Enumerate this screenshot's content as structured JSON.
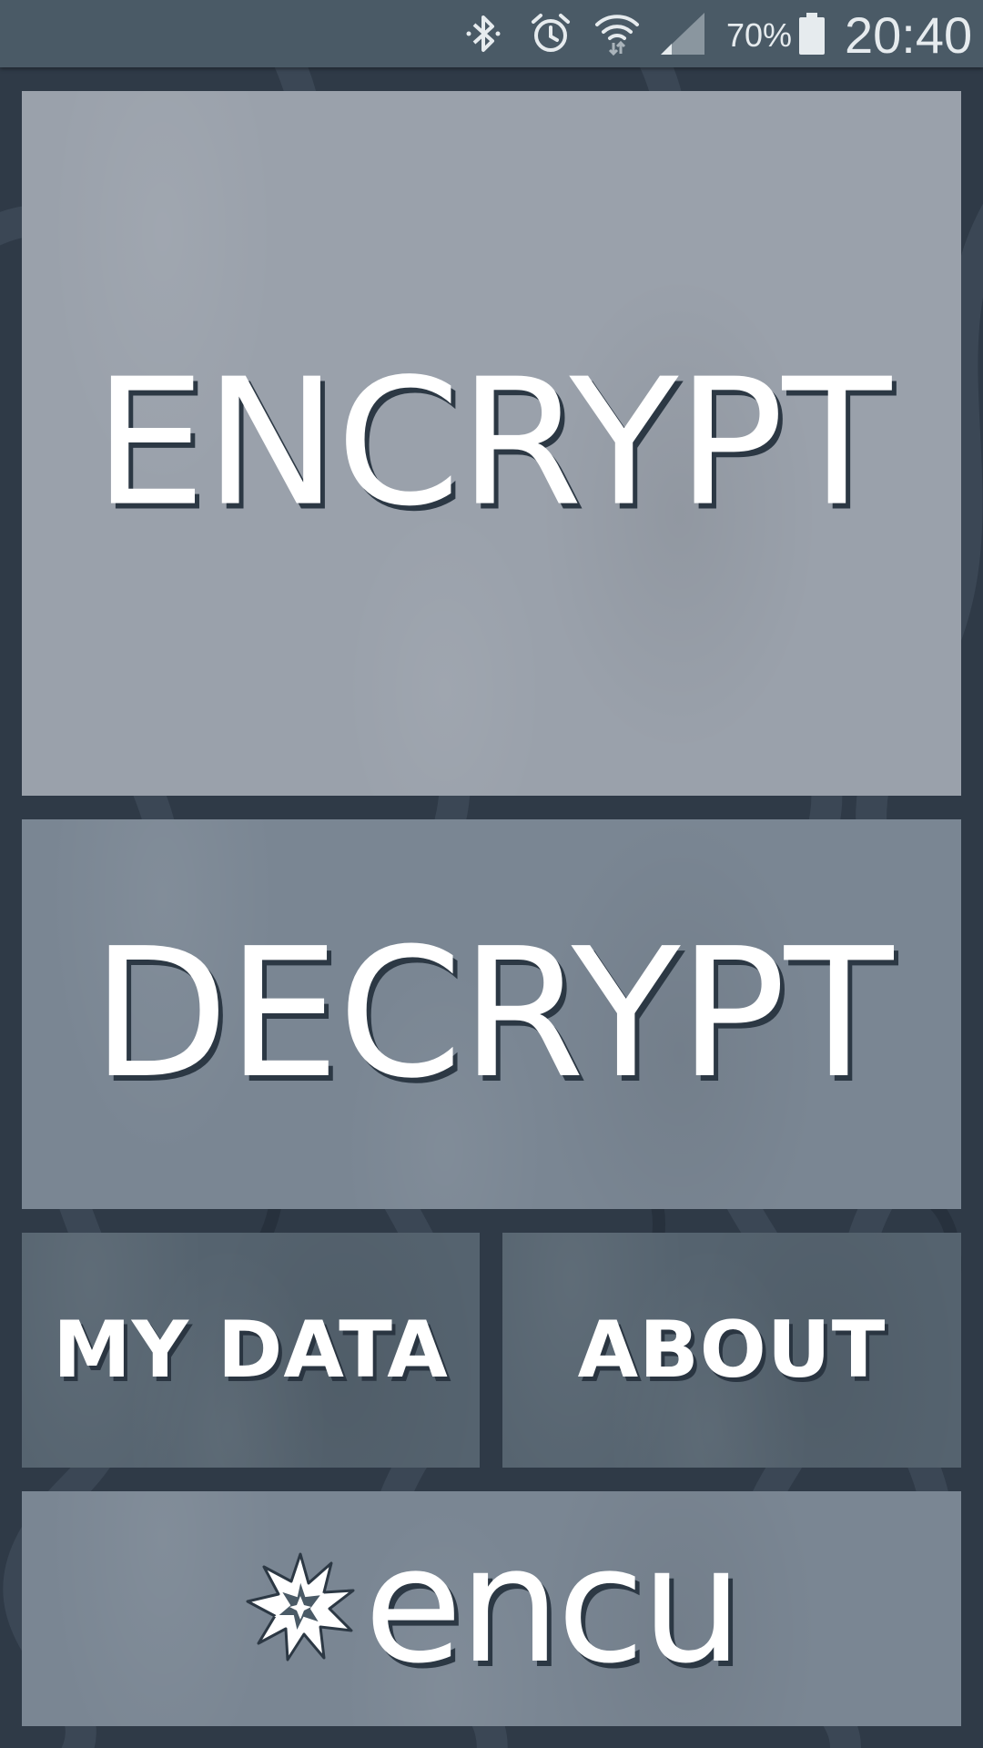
{
  "status_bar": {
    "battery_percent": "70%",
    "time": "20:40",
    "icons": [
      "bluetooth-icon",
      "alarm-icon",
      "wifi-icon",
      "signal-icon",
      "battery-icon"
    ]
  },
  "tiles": {
    "encrypt": {
      "label": "ENCRYPT"
    },
    "decrypt": {
      "label": "DECRYPT"
    },
    "my_data": {
      "label": "MY DATA"
    },
    "about": {
      "label": "ABOUT"
    }
  },
  "brand": {
    "name": "encu",
    "logo_icon": "starburst-icon"
  },
  "colors": {
    "background": "#2f3a47",
    "status_bar": "#4a5a66",
    "encrypt_tile": "#9aa1ab",
    "decrypt_tile": "#7a8693",
    "small_tiles": "#55636f",
    "label_text": "#ffffff",
    "label_shadow": "#2c3844"
  }
}
